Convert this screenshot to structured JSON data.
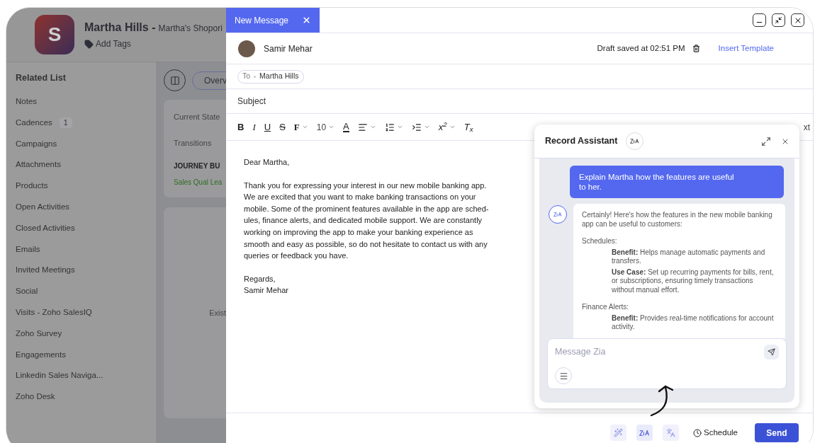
{
  "record": {
    "avatar_letter": "S",
    "name": "Martha Hills -",
    "account": "Martha's Shopori",
    "add_tags": "Add Tags"
  },
  "related_list": {
    "title": "Related List",
    "items": [
      {
        "label": "Notes"
      },
      {
        "label": "Cadences",
        "count": "1"
      },
      {
        "label": "Campaigns"
      },
      {
        "label": "Attachments"
      },
      {
        "label": "Products"
      },
      {
        "label": "Open Activities"
      },
      {
        "label": "Closed Activities"
      },
      {
        "label": "Emails"
      },
      {
        "label": "Invited Meetings"
      },
      {
        "label": "Social"
      },
      {
        "label": "Visits - Zoho SalesIQ"
      },
      {
        "label": "Zoho Survey"
      },
      {
        "label": "Engagements"
      },
      {
        "label": "Linkedin Sales Naviga..."
      },
      {
        "label": "Zoho Desk"
      }
    ]
  },
  "overview": {
    "tab": "Overv",
    "current_state": "Current State",
    "transitions": "Transitions",
    "journey": "JOURNEY BU",
    "state": "Sales Qual Lea",
    "empty_text": "Exist"
  },
  "composer": {
    "title": "New Message",
    "sender": "Samir Mehar",
    "draft_status": "Draft saved at 02:51 PM",
    "insert_template": "Insert Template",
    "to_label": "To",
    "recipient": "Martha Hills",
    "subject_placeholder": "Subject",
    "toolbar": [
      {
        "kind": "bold",
        "label": "B",
        "dropdown": false
      },
      {
        "kind": "italic",
        "label": "I",
        "dropdown": false
      },
      {
        "kind": "underline",
        "label": "U",
        "dropdown": false
      },
      {
        "kind": "strike",
        "label": "S",
        "dropdown": false
      },
      {
        "kind": "font",
        "label": "F",
        "dropdown": true
      },
      {
        "kind": "size",
        "label": "10",
        "dropdown": true
      },
      {
        "kind": "color",
        "label": "A",
        "dropdown": false
      },
      {
        "kind": "align",
        "dropdown": true
      },
      {
        "kind": "numbered-list",
        "dropdown": true
      },
      {
        "kind": "indent",
        "dropdown": true
      },
      {
        "kind": "script",
        "label": "x$^{2}$",
        "dropdown": true
      },
      {
        "kind": "clear",
        "label": "T$_{x}$",
        "dropdown": false
      }
    ],
    "toolbar_tail": "xt",
    "body": [
      [
        "Dear Martha,"
      ],
      [
        "Thank you for expressing your interest in our new mobile banking app.",
        "We are excited that you want to make banking transactions on your",
        "mobile. Some of the prominent features available in the app are sched-",
        "ules, finance alerts, and dedicated mobile support. We are constantly",
        "working on improving the app to make your banking experience as",
        "smooth and easy as possible, so do not hesitate to contact us with any",
        "queries or feedback you have."
      ],
      [
        "Regards,",
        "Samir Mehar"
      ]
    ],
    "schedule": "Schedule",
    "send": "Send"
  },
  "assistant": {
    "title": "Record Assistant",
    "user_message": "Explain Martha how the features are useful to her.",
    "reply_intro": "Certainly! Here's how the features in the new mobile banking app can be useful to customers:",
    "sections": [
      {
        "heading": "Schedules:",
        "points": [
          "**Benefit:** Helps manage automatic payments and transfers.",
          "**Use Case:** Set up recurring payments for bills, rent, or subscriptions, ensuring timely transactions without manual effort."
        ]
      },
      {
        "heading": "Finance Alerts:",
        "points": [
          "**Benefit:** Provides real-time notifications for account activity."
        ]
      }
    ],
    "input_placeholder": "Message Zia"
  }
}
